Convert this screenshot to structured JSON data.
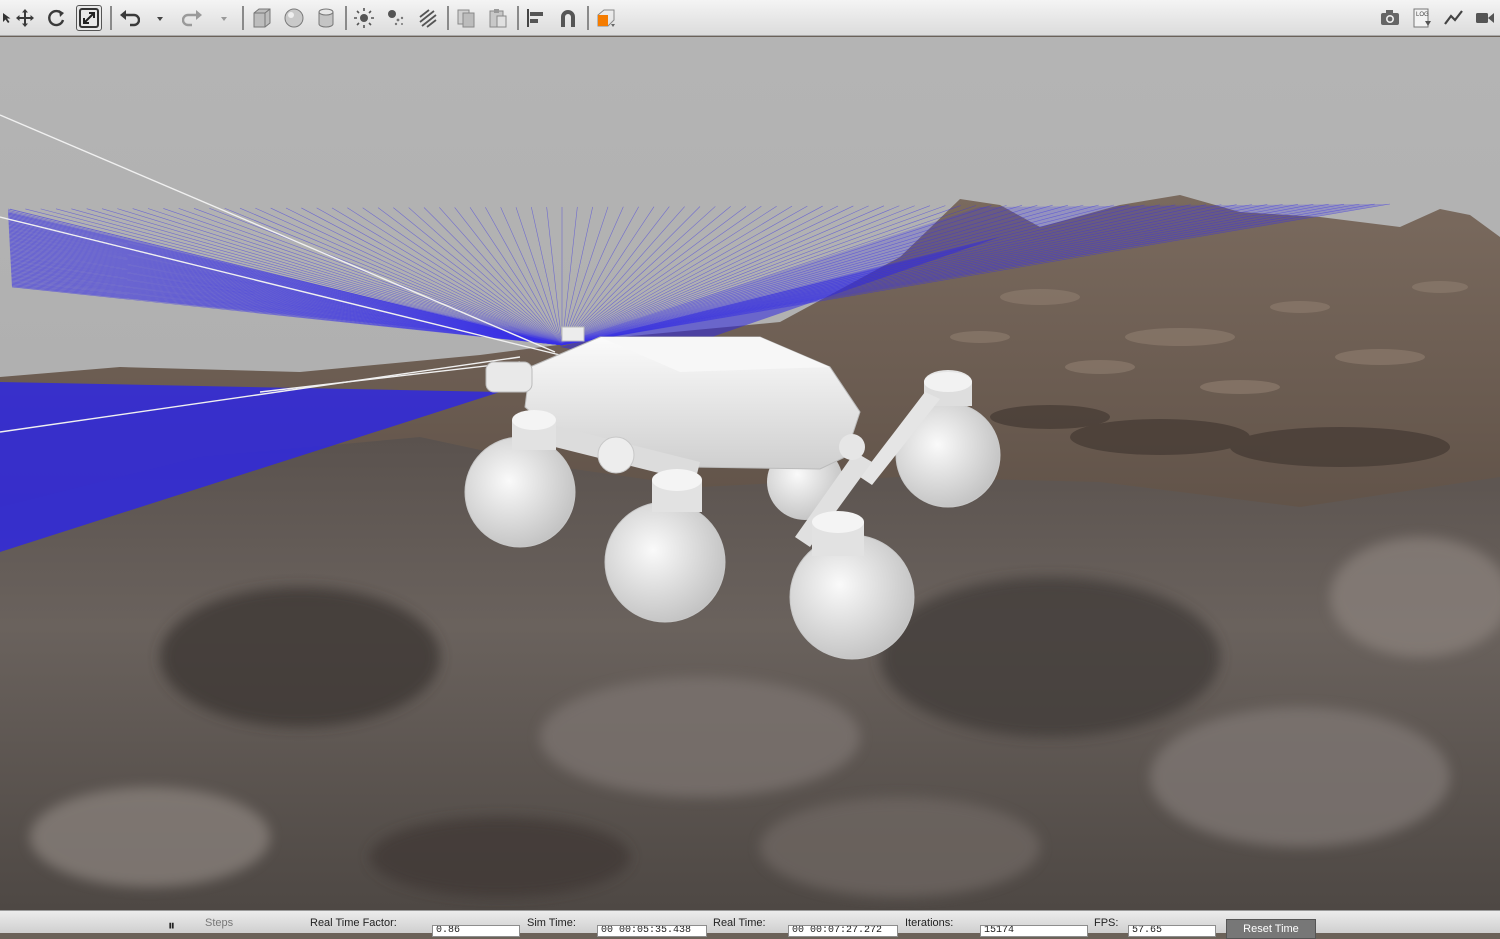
{
  "toolbar": {
    "tools": [
      {
        "name": "select-mode-icon",
        "label": "Select mode"
      },
      {
        "name": "translate-mode-icon",
        "label": "Translate mode"
      },
      {
        "name": "rotate-mode-icon",
        "label": "Rotate mode"
      },
      {
        "name": "scale-mode-icon",
        "label": "Scale mode"
      },
      {
        "name": "undo-icon",
        "label": "Undo"
      },
      {
        "name": "undo-history-chevron-icon",
        "label": "Undo history"
      },
      {
        "name": "redo-icon",
        "label": "Redo"
      },
      {
        "name": "redo-history-chevron-icon",
        "label": "Redo history"
      },
      {
        "name": "box-shape-icon",
        "label": "Box"
      },
      {
        "name": "sphere-shape-icon",
        "label": "Sphere"
      },
      {
        "name": "cylinder-shape-icon",
        "label": "Cylinder"
      },
      {
        "name": "point-light-icon",
        "label": "Point light"
      },
      {
        "name": "spot-light-icon",
        "label": "Spot light"
      },
      {
        "name": "directional-light-icon",
        "label": "Directional light"
      },
      {
        "name": "copy-icon",
        "label": "Copy"
      },
      {
        "name": "paste-icon",
        "label": "Paste"
      },
      {
        "name": "align-icon",
        "label": "Align"
      },
      {
        "name": "snap-magnet-icon",
        "label": "Snap"
      },
      {
        "name": "change-view-angle-icon",
        "label": "View angle"
      },
      {
        "name": "screenshot-camera-icon",
        "label": "Screenshot"
      },
      {
        "name": "log-data-icon",
        "label": "Log data"
      },
      {
        "name": "plot-graph-icon",
        "label": "Plot"
      },
      {
        "name": "video-record-icon",
        "label": "Record video"
      }
    ],
    "active_tool": "scale-mode-icon",
    "accent_color": "#f57c00"
  },
  "viewport": {
    "sky_color": "#b3b3b3",
    "laser_color": "#3a32e6",
    "terrain_color": "#6b5f55",
    "rover_color": "#ececec"
  },
  "statusbar": {
    "pause_label": "⏸",
    "step_label": "Steps",
    "real_time_factor_label": "Real Time Factor:",
    "real_time_factor_value": "0.86",
    "sim_time_label": "Sim Time:",
    "sim_time_value": "00 00:05:35.438",
    "real_time_label": "Real Time:",
    "real_time_value": "00 00:07:27.272",
    "iterations_label": "Iterations:",
    "iterations_value": "15174",
    "fps_label": "FPS:",
    "fps_value": "57.65",
    "reset_time_label": "Reset Time"
  }
}
